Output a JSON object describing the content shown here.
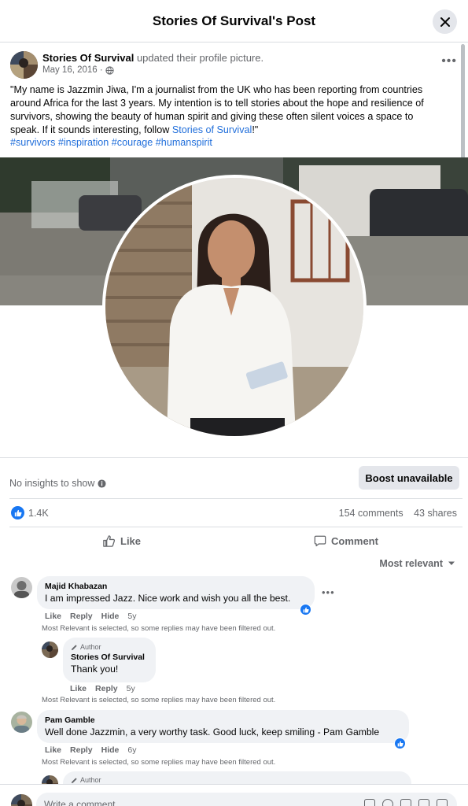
{
  "modal": {
    "title": "Stories Of Survival's Post"
  },
  "post": {
    "author": "Stories Of Survival",
    "action": "updated their profile picture.",
    "date": "May 16, 2016 ·",
    "text_lines": [
      "\"My name is Jazzmin Jiwa, I'm a journalist from the UK who has been reporting from countries",
      "around Africa for the last 3 years. My intention is to tell stories about the hope and resilience of",
      "survivors, showing the beauty of human spirit and giving these often silent voices a space to"
    ],
    "text_last_prefix": "speak. If it sounds interesting, follow ",
    "text_link": "Stories of Survival",
    "text_last_suffix": "!\"",
    "hashtags": "#survivors #inspiration #courage #humanspirit"
  },
  "insights": {
    "label": "No insights to show",
    "boost_label": "Boost unavailable"
  },
  "stats": {
    "reactions": "1.4K",
    "comments": "154 comments",
    "shares": "43 shares"
  },
  "actions": {
    "like": "Like",
    "comment": "Comment",
    "sort": "Most relevant"
  },
  "comments": [
    {
      "name": "Majid Khabazan",
      "text": "I am impressed Jazz. Nice work and wish you all the best.",
      "like": "Like",
      "reply": "Reply",
      "hide": "Hide",
      "time": "5y",
      "note": "Most Relevant is selected, so some replies may have been filtered out."
    },
    {
      "author_tag": "Author",
      "name": "Stories Of Survival",
      "text": "Thank you!",
      "like": "Like",
      "reply": "Reply",
      "time": "5y",
      "note": "Most Relevant is selected, so some replies may have been filtered out."
    },
    {
      "name": "Pam Gamble",
      "text": "Well done Jazzmin, a very worthy task. Good luck, keep smiling - Pam Gamble",
      "like": "Like",
      "reply": "Reply",
      "hide": "Hide",
      "time": "6y",
      "note": "Most Relevant is selected, so some replies may have been filtered out."
    },
    {
      "author_tag": "Author"
    }
  ],
  "composer": {
    "placeholder": "Write a comment..."
  },
  "colors": {
    "accent": "#1877f2",
    "link": "#216fdb",
    "muted": "#65676b",
    "bubble": "#f0f2f5"
  }
}
